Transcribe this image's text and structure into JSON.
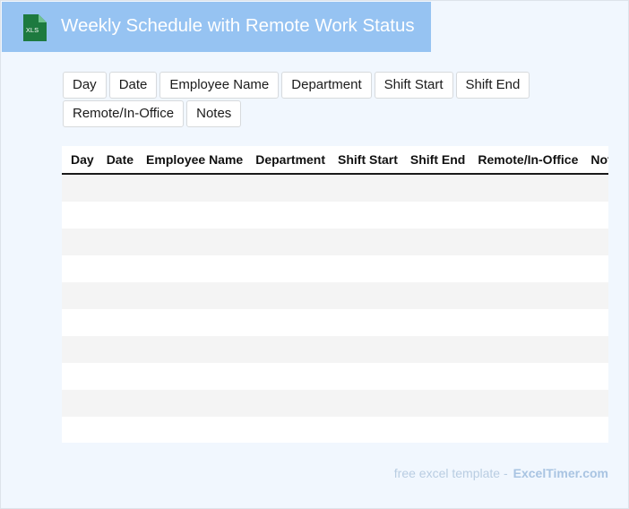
{
  "app": {
    "icon_name": "xls-file-icon",
    "icon_text": "XLS",
    "title": "Weekly Schedule with Remote Work Status",
    "accent": "#96c3f2",
    "icon_color": "#1d7a3f"
  },
  "columns": [
    "Day",
    "Date",
    "Employee Name",
    "Department",
    "Shift Start",
    "Shift End",
    "Remote/In-Office",
    "Notes"
  ],
  "table": {
    "headers": [
      "Day",
      "Date",
      "Employee Name",
      "Department",
      "Shift Start",
      "Shift End",
      "Remote/In-Office",
      "Notes"
    ],
    "rows": [
      [
        "",
        "",
        "",
        "",
        "",
        "",
        "",
        ""
      ],
      [
        "",
        "",
        "",
        "",
        "",
        "",
        "",
        ""
      ],
      [
        "",
        "",
        "",
        "",
        "",
        "",
        "",
        ""
      ],
      [
        "",
        "",
        "",
        "",
        "",
        "",
        "",
        ""
      ],
      [
        "",
        "",
        "",
        "",
        "",
        "",
        "",
        ""
      ],
      [
        "",
        "",
        "",
        "",
        "",
        "",
        "",
        ""
      ],
      [
        "",
        "",
        "",
        "",
        "",
        "",
        "",
        ""
      ],
      [
        "",
        "",
        "",
        "",
        "",
        "",
        "",
        ""
      ],
      [
        "",
        "",
        "",
        "",
        "",
        "",
        "",
        ""
      ],
      [
        "",
        "",
        "",
        "",
        "",
        "",
        "",
        ""
      ]
    ]
  },
  "footer": {
    "text": "free excel template -",
    "brand": "ExcelTimer.com"
  }
}
